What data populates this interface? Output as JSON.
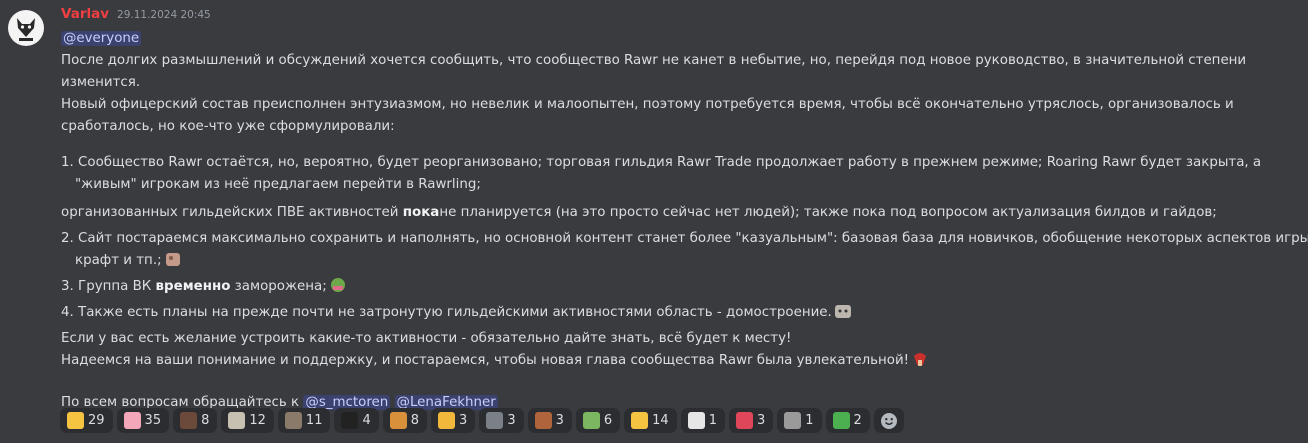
{
  "message": {
    "author": "Varlav",
    "timestamp": "29.11.2024 20:45",
    "mention_everyone": "@everyone",
    "p1": "После долгих размышлений и обсуждений хочется сообщить, что сообщество Rawr не канет в небытие, но, перейдя под новое руководство, в значительной степени",
    "p1b": "изменится.",
    "p2": "Новый офицерский состав преисполнен энтузиазмом, но невелик и малоопытен, поэтому потребуется время, чтобы всё окончательно утряслось, организовалось и",
    "p2b": "сработалось, но кое-что уже сформулировали:",
    "item1": "1. Сообщество Rawr остаётся, но, вероятно, будет реорганизовано; торговая гильдия Rawr Trade продолжает работу в прежнем режиме; Roaring Rawr будет закрыта, а",
    "item1b": "\"живым\" игрокам из неё предлагаем перейти в Rawrling;",
    "item1c_pre": "организованных гильдейских ПВЕ активностей ",
    "item1c_bold": "пока",
    "item1c_post": "не планируется (на это просто сейчас нет людей); также пока под вопросом актуализация билдов и гайдов;",
    "item2": "2. Сайт постараемся максимально сохранить и наполнять, но основной контент станет более \"казуальным\": базовая база для новичков, обобщение некоторых аспектов игры,",
    "item2b": "крафт и тп.;",
    "item3_pre": "3. Группа ВК ",
    "item3_bold": "временно",
    "item3_post": " заморожена;",
    "item4": "4. Также есть планы на прежде почти не затронутую гильдейскими активностями область - домостроение.",
    "p3": "Если у вас есть желание устроить какие-то активности - обязательно дайте знать, всё будет к месту!",
    "p4": "Надеемся на ваши понимание и поддержку, и постараемся, чтобы новая глава сообщества Rawr была увлекательной!",
    "p5": "По всем вопросам обращайтесь к",
    "mention1": "@s_mctoren",
    "mention2": "@LenaFekhner"
  },
  "reactions": [
    {
      "icon": "sparkles-icon",
      "count": "29",
      "color": "#f5c542"
    },
    {
      "icon": "heart-icon",
      "count": "35",
      "color": "#f4a7b9"
    },
    {
      "icon": "anime-girl-icon",
      "count": "8",
      "color": "#6b4a3a"
    },
    {
      "icon": "cat-icon",
      "count": "12",
      "color": "#c8c0b0"
    },
    {
      "icon": "cat-photo-icon",
      "count": "11",
      "color": "#8a7a6a"
    },
    {
      "icon": "black-cat-icon",
      "count": "4",
      "color": "#222222"
    },
    {
      "icon": "game-icon",
      "count": "8",
      "color": "#d9903a"
    },
    {
      "icon": "cat-face-icon",
      "count": "3",
      "color": "#f2b83c"
    },
    {
      "icon": "photo-icon",
      "count": "3",
      "color": "#7a7f88"
    },
    {
      "icon": "face-icon",
      "count": "3",
      "color": "#b0643c"
    },
    {
      "icon": "house-icon",
      "count": "6",
      "color": "#7bb661"
    },
    {
      "icon": "thumbs-up-icon",
      "count": "14",
      "color": "#f5c542"
    },
    {
      "icon": "rabbit-icon",
      "count": "1",
      "color": "#e6e6e6"
    },
    {
      "icon": "party-popper-icon",
      "count": "3",
      "color": "#e0465a"
    },
    {
      "icon": "figure-icon",
      "count": "1",
      "color": "#9a9a9a"
    },
    {
      "icon": "check-mark-icon",
      "count": "2",
      "color": "#4caf50"
    }
  ]
}
